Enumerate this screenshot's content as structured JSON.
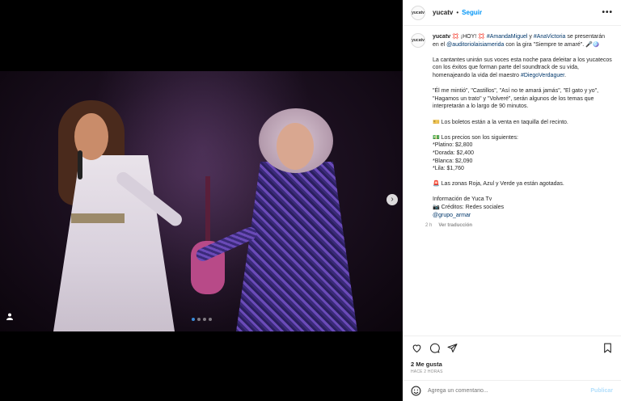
{
  "post": {
    "username": "yucatv",
    "avatar_text": "yucatv",
    "follow_label": "Seguir",
    "separator": "•",
    "more_label": "•••"
  },
  "caption": {
    "username": "yucatv",
    "line1": " 💢 ¡HOY! 💢 ",
    "tag1": "#AmandaMiguel",
    "and": " y ",
    "tag2": "#AnaVictoria",
    "line1b": " se presentarán en el ",
    "mention1": "@auditoriolaisiamerida",
    "line1c": " con la gira \"Siempre te amaré\". 🎤🪩",
    "para2": "La cantantes unirán sus voces esta noche para deleitar a los yucatecos con los éxitos que forman parte del soundtrack de su vida, homenajeando la vida del maestro ",
    "tag3": "#DiegoVerdaguer",
    "para2_end": ".",
    "para3": "\"Él me mintió\", \"Castillos\", \"Así no te amará jamás\", \"El gato y yo\", \"Hagamos un trato\" y \"Volveré\", serán algunos de los temas que interpretarán a lo largo de 90 minutos.",
    "para4": "🎫 Los boletos están a la venta en taquilla del recinto.",
    "para5": "💵 Los precios son los siguientes:\n*Platino: $2,800\n*Dorada: $2,400\n*Blanca: $2,090\n*Lila: $1,760",
    "para6": "🚨 Las zonas Roja, Azul y Verde ya están agotadas.",
    "para7": "Información de Yuca Tv\n📷 Créditos: Redes sociales",
    "mention2": "@grupo_armar",
    "time": "2 h",
    "translate": "Ver traducción"
  },
  "engagement": {
    "likes": "2 Me gusta",
    "time_ago": "HACE 2 HORAS"
  },
  "comment": {
    "placeholder": "Agrega un comentario...",
    "publish": "Publicar"
  },
  "media": {
    "next_icon": "›",
    "carousel_dots": 4,
    "active_dot": 0
  },
  "colors": {
    "accent": "#0095f6",
    "link": "#00376b",
    "muted": "#8e8e8e"
  }
}
